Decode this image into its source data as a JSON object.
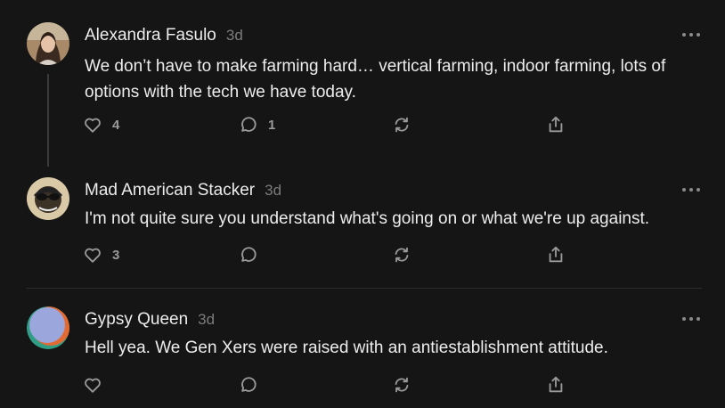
{
  "comments": [
    {
      "author": "Alexandra Fasulo",
      "time": "3d",
      "text": "We don’t have to make farming hard… vertical farming, indoor farming, lots of options with the tech we have today.",
      "likes": "4",
      "replies": "1"
    },
    {
      "author": "Mad American Stacker",
      "time": "3d",
      "text": "I'm not quite sure you understand what's going on or what we're up against.",
      "likes": "3",
      "replies": ""
    },
    {
      "author": "Gypsy Queen",
      "time": "3d",
      "text": "Hell yea. We Gen Xers were raised with an antiestablishment attitude.",
      "likes": "",
      "replies": ""
    }
  ],
  "colors": {
    "background": "#151515",
    "text": "#ededed",
    "muted": "#7c7c7c",
    "icon": "#9a9a9a"
  },
  "icons": {
    "like": "heart-icon",
    "reply": "speech-bubble-icon",
    "restack": "restack-arrows-icon",
    "share": "share-upload-icon",
    "more": "more-dots-icon"
  }
}
